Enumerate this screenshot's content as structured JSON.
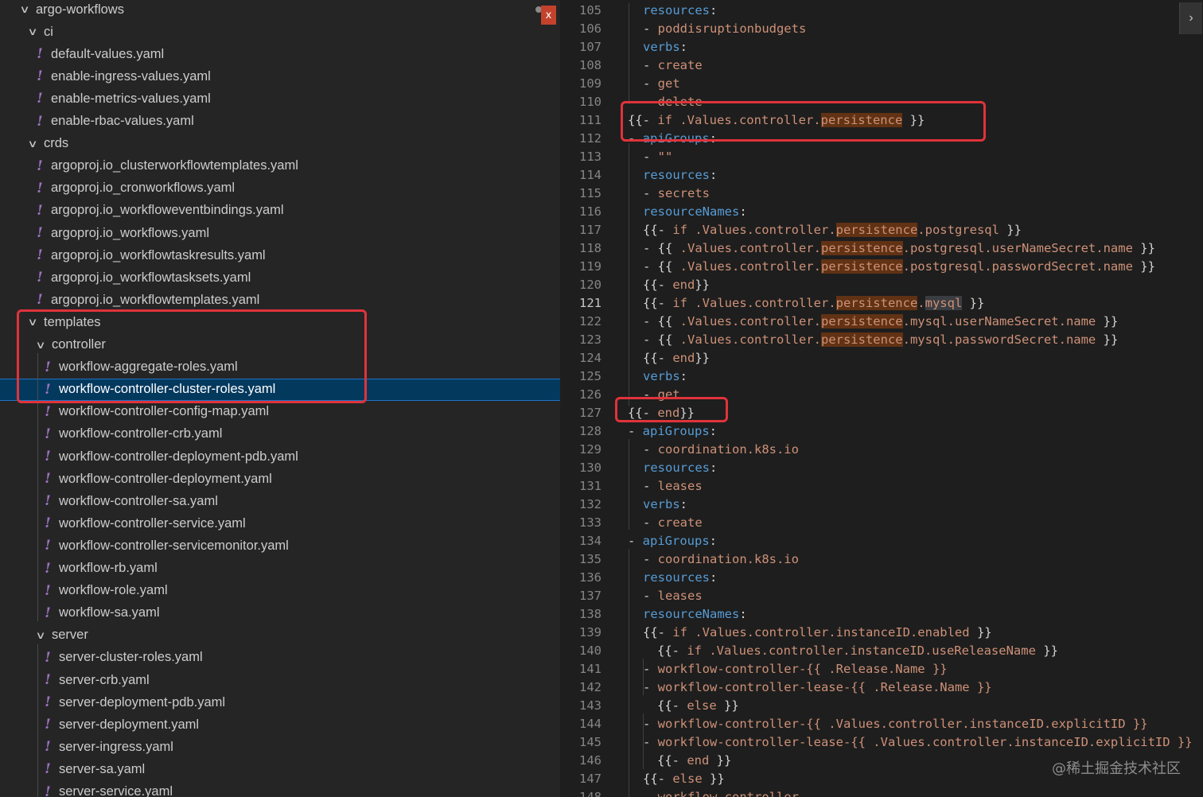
{
  "explorer": {
    "items": [
      {
        "depth": 0,
        "kind": "folder",
        "label": "argo-workflows"
      },
      {
        "depth": 1,
        "kind": "folder",
        "label": "ci"
      },
      {
        "depth": 2,
        "kind": "file",
        "label": "default-values.yaml"
      },
      {
        "depth": 2,
        "kind": "file",
        "label": "enable-ingress-values.yaml"
      },
      {
        "depth": 2,
        "kind": "file",
        "label": "enable-metrics-values.yaml"
      },
      {
        "depth": 2,
        "kind": "file",
        "label": "enable-rbac-values.yaml"
      },
      {
        "depth": 1,
        "kind": "folder",
        "label": "crds"
      },
      {
        "depth": 2,
        "kind": "file",
        "label": "argoproj.io_clusterworkflowtemplates.yaml"
      },
      {
        "depth": 2,
        "kind": "file",
        "label": "argoproj.io_cronworkflows.yaml"
      },
      {
        "depth": 2,
        "kind": "file",
        "label": "argoproj.io_workfloweventbindings.yaml"
      },
      {
        "depth": 2,
        "kind": "file",
        "label": "argoproj.io_workflows.yaml"
      },
      {
        "depth": 2,
        "kind": "file",
        "label": "argoproj.io_workflowtaskresults.yaml"
      },
      {
        "depth": 2,
        "kind": "file",
        "label": "argoproj.io_workflowtasksets.yaml"
      },
      {
        "depth": 2,
        "kind": "file",
        "label": "argoproj.io_workflowtemplates.yaml"
      },
      {
        "depth": 1,
        "kind": "folder",
        "label": "templates"
      },
      {
        "depth": 2,
        "kind": "folder",
        "label": "controller"
      },
      {
        "depth": 3,
        "kind": "file",
        "label": "workflow-aggregate-roles.yaml"
      },
      {
        "depth": 3,
        "kind": "file",
        "label": "workflow-controller-cluster-roles.yaml",
        "selected": true
      },
      {
        "depth": 3,
        "kind": "file",
        "label": "workflow-controller-config-map.yaml"
      },
      {
        "depth": 3,
        "kind": "file",
        "label": "workflow-controller-crb.yaml"
      },
      {
        "depth": 3,
        "kind": "file",
        "label": "workflow-controller-deployment-pdb.yaml"
      },
      {
        "depth": 3,
        "kind": "file",
        "label": "workflow-controller-deployment.yaml"
      },
      {
        "depth": 3,
        "kind": "file",
        "label": "workflow-controller-sa.yaml"
      },
      {
        "depth": 3,
        "kind": "file",
        "label": "workflow-controller-service.yaml"
      },
      {
        "depth": 3,
        "kind": "file",
        "label": "workflow-controller-servicemonitor.yaml"
      },
      {
        "depth": 3,
        "kind": "file",
        "label": "workflow-rb.yaml"
      },
      {
        "depth": 3,
        "kind": "file",
        "label": "workflow-role.yaml"
      },
      {
        "depth": 3,
        "kind": "file",
        "label": "workflow-sa.yaml"
      },
      {
        "depth": 2,
        "kind": "folder",
        "label": "server"
      },
      {
        "depth": 3,
        "kind": "file",
        "label": "server-cluster-roles.yaml"
      },
      {
        "depth": 3,
        "kind": "file",
        "label": "server-crb.yaml"
      },
      {
        "depth": 3,
        "kind": "file",
        "label": "server-deployment-pdb.yaml"
      },
      {
        "depth": 3,
        "kind": "file",
        "label": "server-deployment.yaml"
      },
      {
        "depth": 3,
        "kind": "file",
        "label": "server-ingress.yaml"
      },
      {
        "depth": 3,
        "kind": "file",
        "label": "server-sa.yaml"
      },
      {
        "depth": 3,
        "kind": "file",
        "label": "server-service.yaml"
      }
    ],
    "close_badge": "x",
    "icons": {
      "folder": "chevron-down-icon",
      "file": "yaml-file-icon"
    }
  },
  "editor": {
    "current_line": "121",
    "lines": [
      {
        "n": "105",
        "ind": 1,
        "t": [
          [
            "k",
            "resources"
          ],
          [
            "p",
            ":"
          ]
        ]
      },
      {
        "n": "106",
        "ind": 1,
        "t": [
          [
            "p",
            "- "
          ],
          [
            "s",
            "poddisruptionbudgets"
          ]
        ]
      },
      {
        "n": "107",
        "ind": 1,
        "t": [
          [
            "k",
            "verbs"
          ],
          [
            "p",
            ":"
          ]
        ]
      },
      {
        "n": "108",
        "ind": 1,
        "t": [
          [
            "p",
            "- "
          ],
          [
            "s",
            "create"
          ]
        ]
      },
      {
        "n": "109",
        "ind": 1,
        "t": [
          [
            "p",
            "- "
          ],
          [
            "s",
            "get"
          ]
        ]
      },
      {
        "n": "110",
        "ind": 1,
        "t": [
          [
            "p",
            "- "
          ],
          [
            "s",
            "delete"
          ]
        ]
      },
      {
        "n": "111",
        "ind": 0,
        "t": [
          [
            "p",
            "{{- "
          ],
          [
            "s",
            "if .Values.controller."
          ],
          [
            "h",
            "persistence"
          ],
          [
            "p",
            " }}"
          ]
        ]
      },
      {
        "n": "112",
        "ind": 0,
        "t": [
          [
            "p",
            "- "
          ],
          [
            "k",
            "apiGroups"
          ],
          [
            "p",
            ":"
          ]
        ]
      },
      {
        "n": "113",
        "ind": 1,
        "t": [
          [
            "p",
            "- "
          ],
          [
            "s",
            "\"\""
          ]
        ]
      },
      {
        "n": "114",
        "ind": 1,
        "t": [
          [
            "k",
            "resources"
          ],
          [
            "p",
            ":"
          ]
        ]
      },
      {
        "n": "115",
        "ind": 1,
        "t": [
          [
            "p",
            "- "
          ],
          [
            "s",
            "secrets"
          ]
        ]
      },
      {
        "n": "116",
        "ind": 1,
        "t": [
          [
            "k",
            "resourceNames"
          ],
          [
            "p",
            ":"
          ]
        ]
      },
      {
        "n": "117",
        "ind": 1,
        "t": [
          [
            "p",
            "{{- "
          ],
          [
            "s",
            "if .Values.controller."
          ],
          [
            "h",
            "persistence"
          ],
          [
            "s",
            ".postgresql"
          ],
          [
            "p",
            " }}"
          ]
        ]
      },
      {
        "n": "118",
        "ind": 1,
        "t": [
          [
            "p",
            "- {{ "
          ],
          [
            "s",
            ".Values.controller."
          ],
          [
            "h",
            "persistence"
          ],
          [
            "s",
            ".postgresql.userNameSecret.name"
          ],
          [
            "p",
            " }}"
          ]
        ]
      },
      {
        "n": "119",
        "ind": 1,
        "t": [
          [
            "p",
            "- {{ "
          ],
          [
            "s",
            ".Values.controller."
          ],
          [
            "h",
            "persistence"
          ],
          [
            "s",
            ".postgresql.passwordSecret.name"
          ],
          [
            "p",
            " }}"
          ]
        ]
      },
      {
        "n": "120",
        "ind": 1,
        "t": [
          [
            "p",
            "{{- "
          ],
          [
            "s",
            "end"
          ],
          [
            "p",
            "}}"
          ]
        ]
      },
      {
        "n": "121",
        "ind": 1,
        "t": [
          [
            "p",
            "{{- "
          ],
          [
            "s",
            "if .Values.controller."
          ],
          [
            "h",
            "persistence"
          ],
          [
            "s",
            "."
          ],
          [
            "g",
            "mysql"
          ],
          [
            "p",
            " }}"
          ]
        ]
      },
      {
        "n": "122",
        "ind": 1,
        "t": [
          [
            "p",
            "- {{ "
          ],
          [
            "s",
            ".Values.controller."
          ],
          [
            "h",
            "persistence"
          ],
          [
            "s",
            ".mysql.userNameSecret.name"
          ],
          [
            "p",
            " }}"
          ]
        ]
      },
      {
        "n": "123",
        "ind": 1,
        "t": [
          [
            "p",
            "- {{ "
          ],
          [
            "s",
            ".Values.controller."
          ],
          [
            "h",
            "persistence"
          ],
          [
            "s",
            ".mysql.passwordSecret.name"
          ],
          [
            "p",
            " }}"
          ]
        ]
      },
      {
        "n": "124",
        "ind": 1,
        "t": [
          [
            "p",
            "{{- "
          ],
          [
            "s",
            "end"
          ],
          [
            "p",
            "}}"
          ]
        ]
      },
      {
        "n": "125",
        "ind": 1,
        "t": [
          [
            "k",
            "verbs"
          ],
          [
            "p",
            ":"
          ]
        ]
      },
      {
        "n": "126",
        "ind": 1,
        "t": [
          [
            "p",
            "- "
          ],
          [
            "s",
            "get"
          ]
        ]
      },
      {
        "n": "127",
        "ind": 0,
        "t": [
          [
            "p",
            "{{- "
          ],
          [
            "s",
            "end"
          ],
          [
            "p",
            "}}"
          ]
        ]
      },
      {
        "n": "128",
        "ind": 0,
        "t": [
          [
            "p",
            "- "
          ],
          [
            "k",
            "apiGroups"
          ],
          [
            "p",
            ":"
          ]
        ]
      },
      {
        "n": "129",
        "ind": 1,
        "t": [
          [
            "p",
            "- "
          ],
          [
            "s",
            "coordination.k8s.io"
          ]
        ]
      },
      {
        "n": "130",
        "ind": 1,
        "t": [
          [
            "k",
            "resources"
          ],
          [
            "p",
            ":"
          ]
        ]
      },
      {
        "n": "131",
        "ind": 1,
        "t": [
          [
            "p",
            "- "
          ],
          [
            "s",
            "leases"
          ]
        ]
      },
      {
        "n": "132",
        "ind": 1,
        "t": [
          [
            "k",
            "verbs"
          ],
          [
            "p",
            ":"
          ]
        ]
      },
      {
        "n": "133",
        "ind": 1,
        "t": [
          [
            "p",
            "- "
          ],
          [
            "s",
            "create"
          ]
        ]
      },
      {
        "n": "134",
        "ind": 0,
        "t": [
          [
            "p",
            "- "
          ],
          [
            "k",
            "apiGroups"
          ],
          [
            "p",
            ":"
          ]
        ]
      },
      {
        "n": "135",
        "ind": 1,
        "t": [
          [
            "p",
            "- "
          ],
          [
            "s",
            "coordination.k8s.io"
          ]
        ]
      },
      {
        "n": "136",
        "ind": 1,
        "t": [
          [
            "k",
            "resources"
          ],
          [
            "p",
            ":"
          ]
        ]
      },
      {
        "n": "137",
        "ind": 1,
        "t": [
          [
            "p",
            "- "
          ],
          [
            "s",
            "leases"
          ]
        ]
      },
      {
        "n": "138",
        "ind": 1,
        "t": [
          [
            "k",
            "resourceNames"
          ],
          [
            "p",
            ":"
          ]
        ]
      },
      {
        "n": "139",
        "ind": 1,
        "t": [
          [
            "p",
            "{{- "
          ],
          [
            "s",
            "if .Values.controller.instanceID.enabled"
          ],
          [
            "p",
            " }}"
          ]
        ]
      },
      {
        "n": "140",
        "ind": 2,
        "t": [
          [
            "p",
            "{{- "
          ],
          [
            "s",
            "if .Values.controller.instanceID.useReleaseName"
          ],
          [
            "p",
            " }}"
          ]
        ]
      },
      {
        "n": "141",
        "ind": 1,
        "t": [
          [
            "p",
            "- "
          ],
          [
            "s",
            "workflow-controller-{{ .Release.Name }}"
          ]
        ]
      },
      {
        "n": "142",
        "ind": 1,
        "t": [
          [
            "p",
            "- "
          ],
          [
            "s",
            "workflow-controller-lease-{{ .Release.Name }}"
          ]
        ]
      },
      {
        "n": "143",
        "ind": 2,
        "t": [
          [
            "p",
            "{{- "
          ],
          [
            "s",
            "else"
          ],
          [
            "p",
            " }}"
          ]
        ]
      },
      {
        "n": "144",
        "ind": 1,
        "t": [
          [
            "p",
            "- "
          ],
          [
            "s",
            "workflow-controller-{{ .Values.controller.instanceID.explicitID }}"
          ]
        ]
      },
      {
        "n": "145",
        "ind": 1,
        "t": [
          [
            "p",
            "- "
          ],
          [
            "s",
            "workflow-controller-lease-{{ .Values.controller.instanceID.explicitID }}"
          ]
        ]
      },
      {
        "n": "146",
        "ind": 2,
        "t": [
          [
            "p",
            "{{- "
          ],
          [
            "s",
            "end"
          ],
          [
            "p",
            " }}"
          ]
        ]
      },
      {
        "n": "147",
        "ind": 1,
        "t": [
          [
            "p",
            "{{- "
          ],
          [
            "s",
            "else"
          ],
          [
            "p",
            " }}"
          ]
        ]
      },
      {
        "n": "148",
        "ind": 1,
        "t": [
          [
            "p",
            "- "
          ],
          [
            "s",
            "workflow-controller"
          ]
        ]
      }
    ]
  },
  "scroll_button": "›",
  "watermark": "@稀土掘金技术社区"
}
